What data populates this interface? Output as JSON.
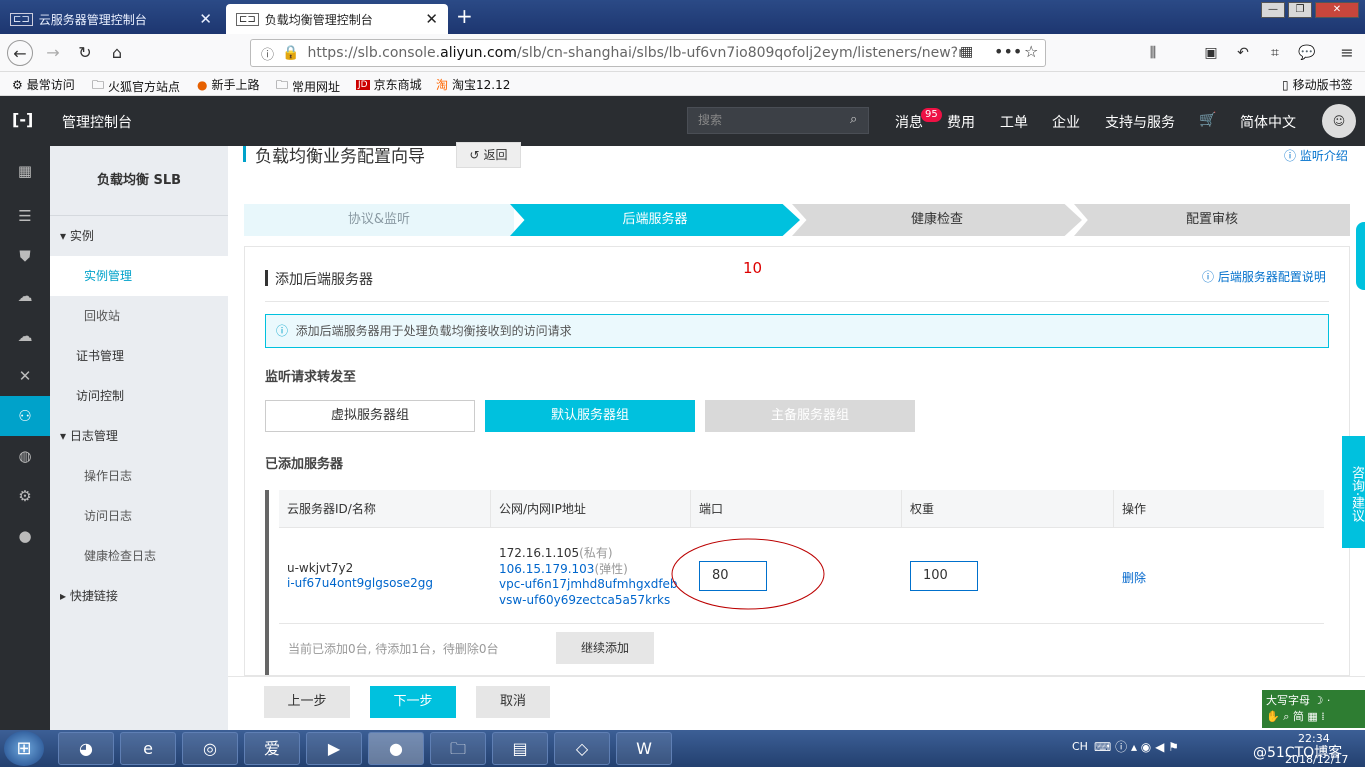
{
  "browser": {
    "tabs": [
      {
        "label": "云服务器管理控制台",
        "active": false
      },
      {
        "label": "负载均衡管理控制台",
        "active": true
      }
    ],
    "url_prefix": "https://slb.console.",
    "url_domain": "aliyun.com",
    "url_rest": "/slb/cn-shanghai/slbs/lb-uf6vn7io809qofolj2eym/listeners/new?r",
    "bookmarks": [
      "最常访问",
      "火狐官方站点",
      "新手上路",
      "常用网址",
      "京东商城",
      "淘宝12.12"
    ],
    "mobile_bookmarks": "移动版书签"
  },
  "console": {
    "brand": "管理控制台",
    "search_placeholder": "搜索",
    "menu": [
      "消息",
      "费用",
      "工单",
      "企业",
      "支持与服务",
      "简体中文"
    ],
    "badge": "95"
  },
  "sidebar": {
    "title": "负载均衡 SLB",
    "items": [
      {
        "label": "实例",
        "type": "group-open"
      },
      {
        "label": "实例管理",
        "type": "sub",
        "selected": true
      },
      {
        "label": "回收站",
        "type": "sub"
      },
      {
        "label": "证书管理",
        "type": "top"
      },
      {
        "label": "访问控制",
        "type": "top"
      },
      {
        "label": "日志管理",
        "type": "group-open"
      },
      {
        "label": "操作日志",
        "type": "sub"
      },
      {
        "label": "访问日志",
        "type": "sub"
      },
      {
        "label": "健康检查日志",
        "type": "sub"
      },
      {
        "label": "快捷链接",
        "type": "group-closed"
      }
    ]
  },
  "page": {
    "title": "负载均衡业务配置向导",
    "back": "返回",
    "help": "监听介绍",
    "steps": [
      "协议&监听",
      "后端服务器",
      "健康检查",
      "配置审核"
    ],
    "section_title": "添加后端服务器",
    "annotation": "10",
    "section_help": "后端服务器配置说明",
    "info": "添加后端服务器用于处理负载均衡接收到的访问请求",
    "forward_label": "监听请求转发至",
    "groups": [
      "虚拟服务器组",
      "默认服务器组",
      "主备服务器组"
    ],
    "added_label": "已添加服务器",
    "table": {
      "headers": [
        "云服务器ID/名称",
        "公网/内网IP地址",
        "端口",
        "权重",
        "操作"
      ],
      "row": {
        "name": "u-wkjvt7y2",
        "id": "i-uf67u4ont9glgsose2gg",
        "ip_private": "172.16.1.105",
        "ip_private_tag": "(私有)",
        "ip_public": "106.15.179.103",
        "ip_public_tag": "(弹性)",
        "vpc": "vpc-uf6n17jmhd8ufmhgxdfeb",
        "vsw": "vsw-uf60y69zectca5a57krks",
        "port": "80",
        "weight": "100",
        "action": "删除"
      }
    },
    "summary": "当前已添加0台, 待添加1台，待删除0台",
    "continue": "继续添加",
    "footer": [
      "上一步",
      "下一步",
      "取消"
    ],
    "float_feedback": "咨询·建议"
  },
  "taskbar": {
    "ime": "大写字母",
    "ime2": "简",
    "time": "22:34",
    "date": "2018/12/17",
    "watermark": "@51CTO博客",
    "lang": "CH"
  },
  "colors": {
    "accent": "#00a2ca",
    "dark": "#2a2d31",
    "sidebar": "#eaedf1"
  }
}
